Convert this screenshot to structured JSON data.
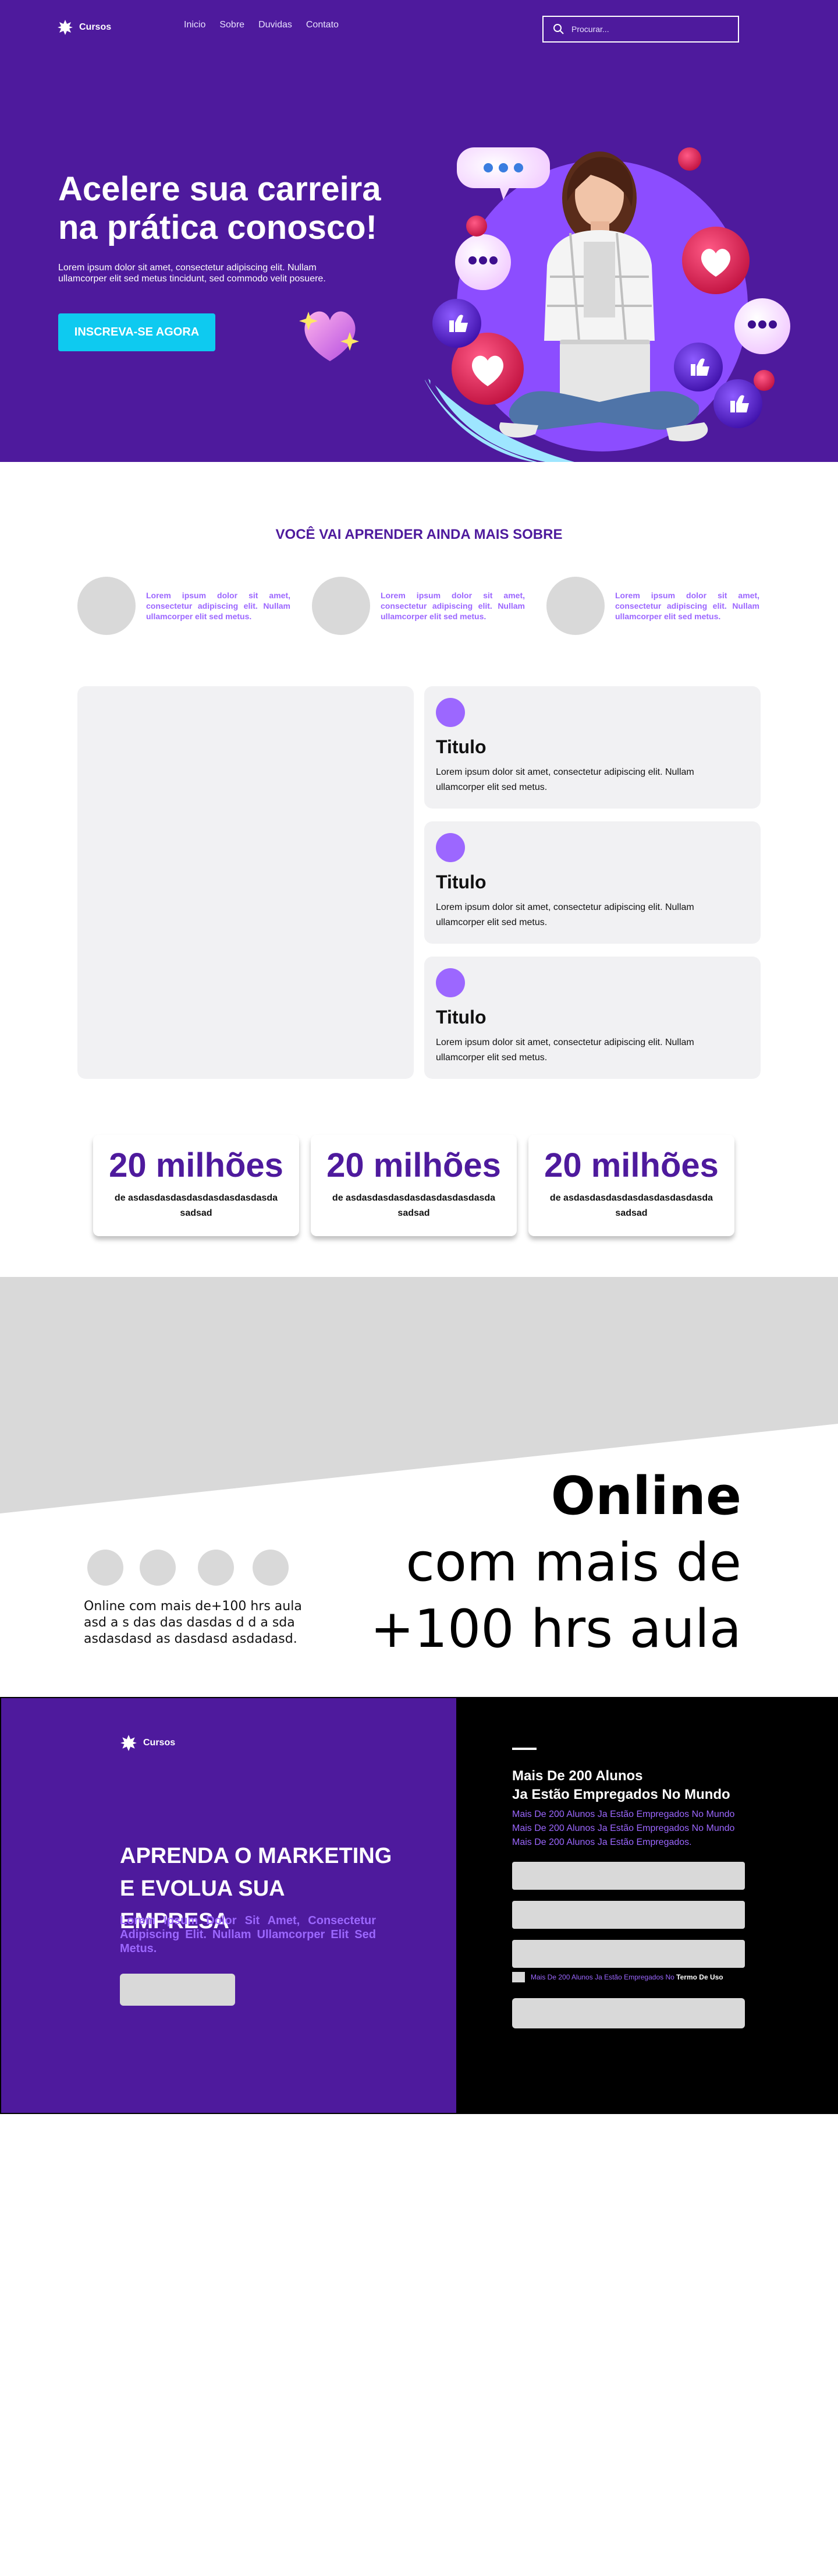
{
  "nav": {
    "logo": "Cursos",
    "links": [
      "Inicio",
      "Sobre",
      "Duvidas",
      "Contato"
    ],
    "search_placeholder": "Procurar..."
  },
  "hero": {
    "title_line1": "Acelere sua carreira",
    "title_line2": "na prática conosco!",
    "text": "Lorem ipsum dolor sit amet, consectetur adipiscing elit. Nullam ullamcorper elit sed metus tincidunt, sed commodo velit posuere.",
    "cta": "INSCREVA-SE AGORA"
  },
  "learn": {
    "title": "VOCÊ VAI APRENDER AINDA MAIS SOBRE",
    "items": [
      "Lorem ipsum dolor sit amet, consectetur adipiscing elit. Nullam ullamcorper elit sed metus.",
      "Lorem ipsum dolor sit amet, consectetur adipiscing elit. Nullam ullamcorper elit sed metus.",
      "Lorem ipsum dolor sit amet, consectetur adipiscing elit. Nullam ullamcorper elit sed metus."
    ]
  },
  "features": [
    {
      "title": "Titulo",
      "text": "Lorem ipsum dolor sit amet, consectetur adipiscing elit. Nullam ullamcorper elit sed metus."
    },
    {
      "title": "Titulo",
      "text": "Lorem ipsum dolor sit amet, consectetur adipiscing elit. Nullam ullamcorper elit sed metus."
    },
    {
      "title": "Titulo",
      "text": "Lorem ipsum dolor sit amet, consectetur adipiscing elit. Nullam ullamcorper elit sed metus."
    }
  ],
  "stats": [
    {
      "number": "20 milhões",
      "label": "de asdasdasdasdasdasdasdasdasda sadsad"
    },
    {
      "number": "20 milhões",
      "label": "de asdasdasdasdasdasdasdasdasda sadsad"
    },
    {
      "number": "20 milhões",
      "label": "de asdasdasdasdasdasdasdasdasda sadsad"
    }
  ],
  "online": {
    "line1": "Online",
    "line2": "com mais de",
    "line3": "+100 hrs aula",
    "small_text": "Online com mais de+100 hrs aula asd a s das das dasdas d d a sda asdasdasd as dasdasd asdadasd."
  },
  "footer": {
    "logo": "Cursos",
    "title_line1": "APRENDA O MARKETING",
    "title_line2": "E EVOLUA SUA EMPRESA",
    "text": "Lorem Ipsum Dolor Sit Amet, Consectetur Adipiscing Elit. Nullam Ullamcorper Elit Sed Metus.",
    "form_title_line1": "Mais De 200 Alunos",
    "form_title_line2": "Ja Estão Empregados No Mundo",
    "form_sub": [
      "Mais De 200 Alunos Ja Estão Empregados No Mundo",
      "Mais De 200 Alunos Ja Estão Empregados No Mundo",
      "Mais De 200 Alunos Ja Estão Empregados."
    ],
    "check_text": "Mais De 200 Alunos Ja Estão Empregados No",
    "check_link": "Termo De Uso"
  },
  "colors": {
    "brand_purple": "#4e1a9d",
    "accent_lilac": "#9c67ff",
    "cta_cyan": "#0ecaf0"
  }
}
